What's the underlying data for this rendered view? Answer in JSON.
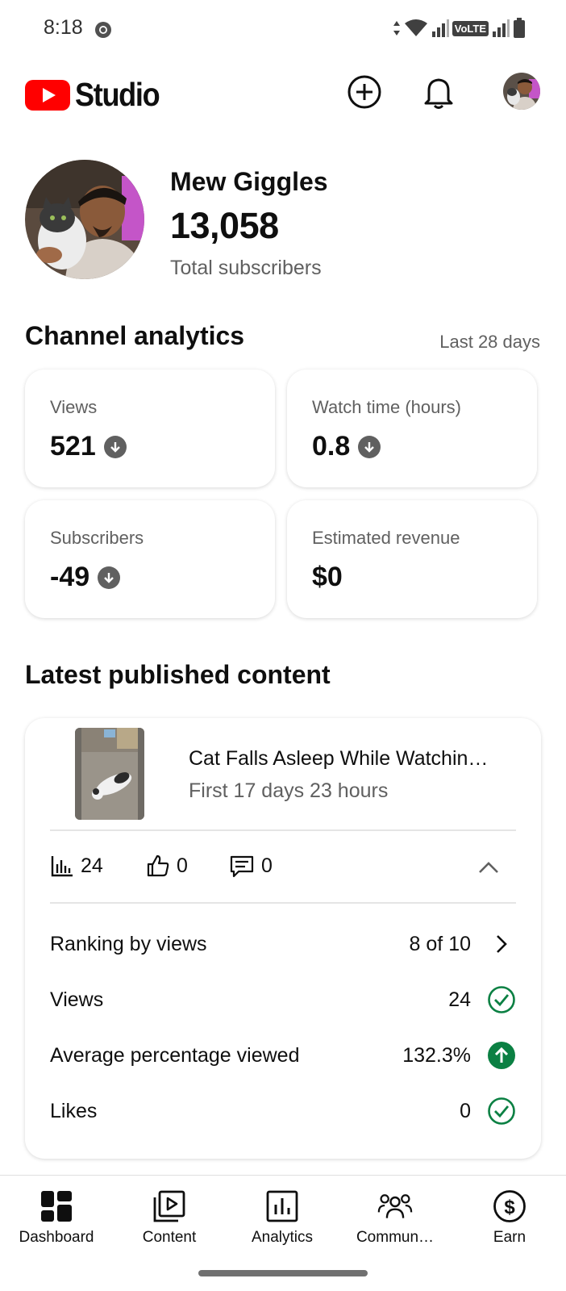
{
  "status_bar": {
    "time": "8:18",
    "network": "VoLTE"
  },
  "header": {
    "app_name": "Studio",
    "icons": [
      "youtube-logo-icon",
      "create-icon",
      "notifications-bell-icon",
      "account-avatar"
    ]
  },
  "channel": {
    "name": "Mew Giggles",
    "subscriber_count": "13,058",
    "subscriber_label": "Total subscribers"
  },
  "analytics": {
    "title": "Channel analytics",
    "range": "Last 28 days",
    "cards": [
      {
        "label": "Views",
        "value": "521",
        "trend": "down"
      },
      {
        "label": "Watch time (hours)",
        "value": "0.8",
        "trend": "down"
      },
      {
        "label": "Subscribers",
        "value": "-49",
        "trend": "down"
      },
      {
        "label": "Estimated revenue",
        "value": "$0",
        "trend": "none"
      }
    ]
  },
  "latest": {
    "title": "Latest published content",
    "video": {
      "title": "Cat Falls Asleep While Watchin…",
      "subtitle": "First 17 days 23 hours"
    },
    "metrics": {
      "views": "24",
      "likes": "0",
      "comments": "0"
    },
    "rows": [
      {
        "label": "Ranking by views",
        "value": "8 of 10",
        "icon": "chevron-right-icon"
      },
      {
        "label": "Views",
        "value": "24",
        "icon": "check-circle-icon"
      },
      {
        "label": "Average percentage viewed",
        "value": "132.3%",
        "icon": "arrow-up-circle-icon"
      },
      {
        "label": "Likes",
        "value": "0",
        "icon": "check-circle-icon"
      }
    ]
  },
  "nav": [
    {
      "label": "Dashboard",
      "icon": "dashboard-icon",
      "active": true
    },
    {
      "label": "Content",
      "icon": "content-icon",
      "active": false
    },
    {
      "label": "Analytics",
      "icon": "analytics-icon",
      "active": false
    },
    {
      "label": "Commun…",
      "icon": "community-icon",
      "active": false
    },
    {
      "label": "Earn",
      "icon": "earn-icon",
      "active": false
    }
  ],
  "colors": {
    "brand_red": "#ff0000",
    "positive_green": "#0b8043",
    "text": "#0f0f0f",
    "secondary_text": "#606060"
  }
}
